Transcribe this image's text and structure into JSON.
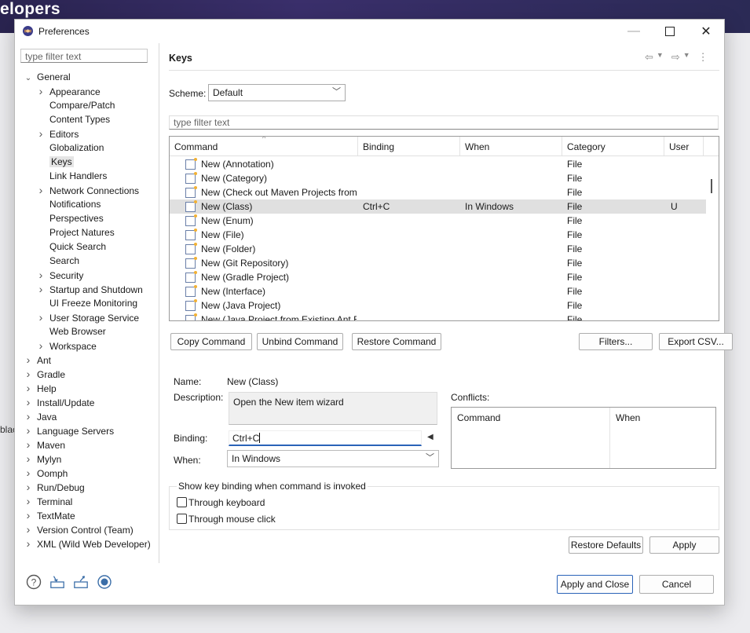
{
  "background": {
    "title_fragment": "elopers",
    "side_fragment": "blac"
  },
  "window": {
    "title": "Preferences"
  },
  "left": {
    "filter_placeholder": "type filter text",
    "tree": [
      {
        "label": "General",
        "depth": 0,
        "toggle": "expanded"
      },
      {
        "label": "Appearance",
        "depth": 1,
        "toggle": "collapsed"
      },
      {
        "label": "Compare/Patch",
        "depth": 1,
        "toggle": "none"
      },
      {
        "label": "Content Types",
        "depth": 1,
        "toggle": "none"
      },
      {
        "label": "Editors",
        "depth": 1,
        "toggle": "collapsed"
      },
      {
        "label": "Globalization",
        "depth": 1,
        "toggle": "none"
      },
      {
        "label": "Keys",
        "depth": 1,
        "toggle": "none",
        "selected": true
      },
      {
        "label": "Link Handlers",
        "depth": 1,
        "toggle": "none"
      },
      {
        "label": "Network Connections",
        "depth": 1,
        "toggle": "collapsed"
      },
      {
        "label": "Notifications",
        "depth": 1,
        "toggle": "none"
      },
      {
        "label": "Perspectives",
        "depth": 1,
        "toggle": "none"
      },
      {
        "label": "Project Natures",
        "depth": 1,
        "toggle": "none"
      },
      {
        "label": "Quick Search",
        "depth": 1,
        "toggle": "none"
      },
      {
        "label": "Search",
        "depth": 1,
        "toggle": "none"
      },
      {
        "label": "Security",
        "depth": 1,
        "toggle": "collapsed"
      },
      {
        "label": "Startup and Shutdown",
        "depth": 1,
        "toggle": "collapsed"
      },
      {
        "label": "UI Freeze Monitoring",
        "depth": 1,
        "toggle": "none"
      },
      {
        "label": "User Storage Service",
        "depth": 1,
        "toggle": "collapsed"
      },
      {
        "label": "Web Browser",
        "depth": 1,
        "toggle": "none"
      },
      {
        "label": "Workspace",
        "depth": 1,
        "toggle": "collapsed"
      },
      {
        "label": "Ant",
        "depth": 0,
        "toggle": "collapsed"
      },
      {
        "label": "Gradle",
        "depth": 0,
        "toggle": "collapsed"
      },
      {
        "label": "Help",
        "depth": 0,
        "toggle": "collapsed"
      },
      {
        "label": "Install/Update",
        "depth": 0,
        "toggle": "collapsed"
      },
      {
        "label": "Java",
        "depth": 0,
        "toggle": "collapsed"
      },
      {
        "label": "Language Servers",
        "depth": 0,
        "toggle": "collapsed"
      },
      {
        "label": "Maven",
        "depth": 0,
        "toggle": "collapsed"
      },
      {
        "label": "Mylyn",
        "depth": 0,
        "toggle": "collapsed"
      },
      {
        "label": "Oomph",
        "depth": 0,
        "toggle": "collapsed"
      },
      {
        "label": "Run/Debug",
        "depth": 0,
        "toggle": "collapsed"
      },
      {
        "label": "Terminal",
        "depth": 0,
        "toggle": "collapsed"
      },
      {
        "label": "TextMate",
        "depth": 0,
        "toggle": "collapsed"
      },
      {
        "label": "Version Control (Team)",
        "depth": 0,
        "toggle": "collapsed"
      },
      {
        "label": "XML (Wild Web Developer)",
        "depth": 0,
        "toggle": "collapsed"
      }
    ]
  },
  "page": {
    "title": "Keys",
    "scheme_label": "Scheme:",
    "scheme_value": "Default",
    "filter_placeholder": "type filter text",
    "columns": [
      "Command",
      "Binding",
      "When",
      "Category",
      "User"
    ],
    "rows": [
      {
        "command": "New (Annotation)",
        "binding": "",
        "when": "",
        "category": "File",
        "user": ""
      },
      {
        "command": "New (Category)",
        "binding": "",
        "when": "",
        "category": "File",
        "user": ""
      },
      {
        "command": "New (Check out Maven Projects from",
        "binding": "",
        "when": "",
        "category": "File",
        "user": ""
      },
      {
        "command": "New (Class)",
        "binding": "Ctrl+C",
        "when": "In Windows",
        "category": "File",
        "user": "U",
        "selected": true
      },
      {
        "command": "New (Enum)",
        "binding": "",
        "when": "",
        "category": "File",
        "user": ""
      },
      {
        "command": "New (File)",
        "binding": "",
        "when": "",
        "category": "File",
        "user": ""
      },
      {
        "command": "New (Folder)",
        "binding": "",
        "when": "",
        "category": "File",
        "user": ""
      },
      {
        "command": "New (Git Repository)",
        "binding": "",
        "when": "",
        "category": "File",
        "user": ""
      },
      {
        "command": "New (Gradle Project)",
        "binding": "",
        "when": "",
        "category": "File",
        "user": ""
      },
      {
        "command": "New (Interface)",
        "binding": "",
        "when": "",
        "category": "File",
        "user": ""
      },
      {
        "command": "New (Java Project)",
        "binding": "",
        "when": "",
        "category": "File",
        "user": ""
      },
      {
        "command": "New (Java Project from Existing Ant Bu",
        "binding": "",
        "when": "",
        "category": "File",
        "user": ""
      }
    ],
    "buttons": {
      "copy": "Copy Command",
      "unbind": "Unbind Command",
      "restore": "Restore Command",
      "filters": "Filters...",
      "export": "Export CSV..."
    },
    "details": {
      "name_label": "Name:",
      "name_value": "New (Class)",
      "description_label": "Description:",
      "description_value": "Open the New item wizard",
      "binding_label": "Binding:",
      "binding_value": "Ctrl+C",
      "when_label": "When:",
      "when_value": "In Windows",
      "conflicts_label": "Conflicts:",
      "conflicts_columns": [
        "Command",
        "When"
      ]
    },
    "show_binding": {
      "title": "Show key binding when command is invoked",
      "keyboard": "Through keyboard",
      "mouse": "Through mouse click"
    },
    "restore_defaults": "Restore Defaults",
    "apply": "Apply"
  },
  "footer": {
    "apply_close": "Apply and Close",
    "cancel": "Cancel"
  }
}
